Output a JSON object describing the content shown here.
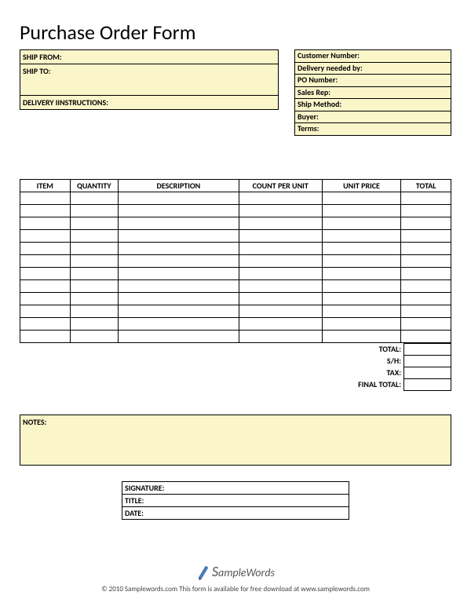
{
  "title": "Purchase Order Form",
  "ship": {
    "from_label": "SHIP FROM:",
    "to_label": "SHIP TO:",
    "delivery_instructions_label": "DELIVERY IINSTRUCTIONS:"
  },
  "meta": {
    "customer_number_label": "Customer Number:",
    "delivery_needed_label": "Delivery needed by:",
    "po_number_label": "PO Number:",
    "sales_rep_label": "Sales Rep:",
    "ship_method_label": "Ship Method:",
    "buyer_label": "Buyer:",
    "terms_label": "Terms:"
  },
  "items": {
    "headers": {
      "item": "ITEM",
      "quantity": "QUANTITY",
      "description": "DESCRIPTION",
      "count_per_unit": "COUNT PER UNIT",
      "unit_price": "UNIT PRICE",
      "total": "TOTAL"
    },
    "rows": [
      {
        "item": "",
        "quantity": "",
        "description": "",
        "count_per_unit": "",
        "unit_price": "",
        "total": ""
      },
      {
        "item": "",
        "quantity": "",
        "description": "",
        "count_per_unit": "",
        "unit_price": "",
        "total": ""
      },
      {
        "item": "",
        "quantity": "",
        "description": "",
        "count_per_unit": "",
        "unit_price": "",
        "total": ""
      },
      {
        "item": "",
        "quantity": "",
        "description": "",
        "count_per_unit": "",
        "unit_price": "",
        "total": ""
      },
      {
        "item": "",
        "quantity": "",
        "description": "",
        "count_per_unit": "",
        "unit_price": "",
        "total": ""
      },
      {
        "item": "",
        "quantity": "",
        "description": "",
        "count_per_unit": "",
        "unit_price": "",
        "total": ""
      },
      {
        "item": "",
        "quantity": "",
        "description": "",
        "count_per_unit": "",
        "unit_price": "",
        "total": ""
      },
      {
        "item": "",
        "quantity": "",
        "description": "",
        "count_per_unit": "",
        "unit_price": "",
        "total": ""
      },
      {
        "item": "",
        "quantity": "",
        "description": "",
        "count_per_unit": "",
        "unit_price": "",
        "total": ""
      },
      {
        "item": "",
        "quantity": "",
        "description": "",
        "count_per_unit": "",
        "unit_price": "",
        "total": ""
      },
      {
        "item": "",
        "quantity": "",
        "description": "",
        "count_per_unit": "",
        "unit_price": "",
        "total": ""
      },
      {
        "item": "",
        "quantity": "",
        "description": "",
        "count_per_unit": "",
        "unit_price": "",
        "total": ""
      }
    ]
  },
  "totals": {
    "total_label": "TOTAL:",
    "sh_label": "S/H:",
    "tax_label": "TAX:",
    "final_total_label": "FINAL TOTAL:",
    "total": "",
    "sh": "",
    "tax": "",
    "final_total": ""
  },
  "notes": {
    "label": "NOTES:"
  },
  "signature": {
    "signature_label": "SIGNATURE:",
    "title_label": "TITLE:",
    "date_label": "DATE:"
  },
  "footer": {
    "brand_prefix": "S",
    "brand_rest": "ampleWords",
    "copyright": "© 2010 Samplewords.com     This form is available for free download at www.samplewords.com"
  }
}
